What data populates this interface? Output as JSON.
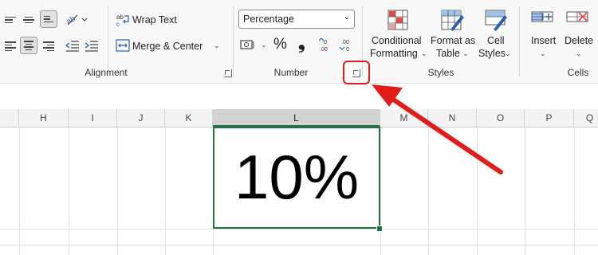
{
  "ribbon": {
    "alignment": {
      "wrap_text": "Wrap Text",
      "merge_center": "Merge & Center",
      "group_label": "Alignment"
    },
    "number": {
      "format_value": "Percentage",
      "percent_symbol": "%",
      "comma_symbol": "❟",
      "group_label": "Number"
    },
    "styles": {
      "conditional_formatting_line1": "Conditional",
      "conditional_formatting_line2": "Formatting",
      "format_as_table_line1": "Format as",
      "format_as_table_line2": "Table",
      "cell_styles_line1": "Cell",
      "cell_styles_line2": "Styles",
      "group_label": "Styles"
    },
    "cells": {
      "insert": "Insert",
      "delete": "Delete",
      "group_label": "Cells"
    }
  },
  "sheet": {
    "columns": [
      "H",
      "I",
      "J",
      "K",
      "L",
      "M",
      "N",
      "O",
      "P",
      "Q"
    ],
    "active_column": "L",
    "active_cell_value": "10%"
  },
  "colors": {
    "accent_green": "#217346",
    "annotation_red": "#e21b1b"
  }
}
